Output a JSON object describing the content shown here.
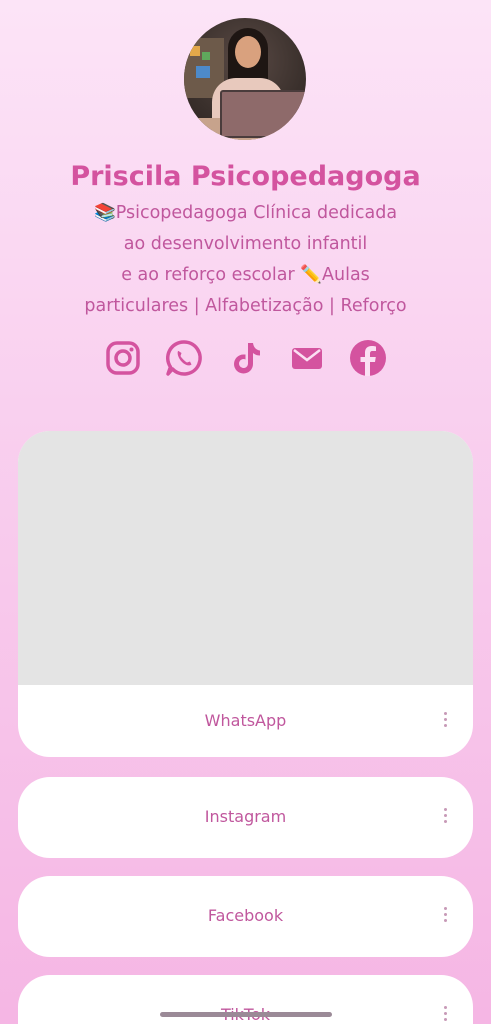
{
  "profile": {
    "name": "Priscila Psicopedagoga",
    "bio_lines": [
      "📚Psicopedagoga Clínica dedicada",
      "ao desenvolvimento infantil",
      "e ao reforço escolar ✏️Aulas",
      "particulares | Alfabetização | Reforço"
    ]
  },
  "socials": [
    {
      "icon": "instagram-icon"
    },
    {
      "icon": "whatsapp-icon"
    },
    {
      "icon": "tiktok-icon"
    },
    {
      "icon": "email-icon"
    },
    {
      "icon": "facebook-icon"
    }
  ],
  "links": [
    {
      "label": "WhatsApp"
    },
    {
      "label": "Instagram"
    },
    {
      "label": "Facebook"
    },
    {
      "label": "TikTok"
    }
  ],
  "colors": {
    "accent": "#d4539f",
    "text": "#c0579d",
    "card": "#ffffff",
    "placeholder": "#e4e4e4"
  }
}
